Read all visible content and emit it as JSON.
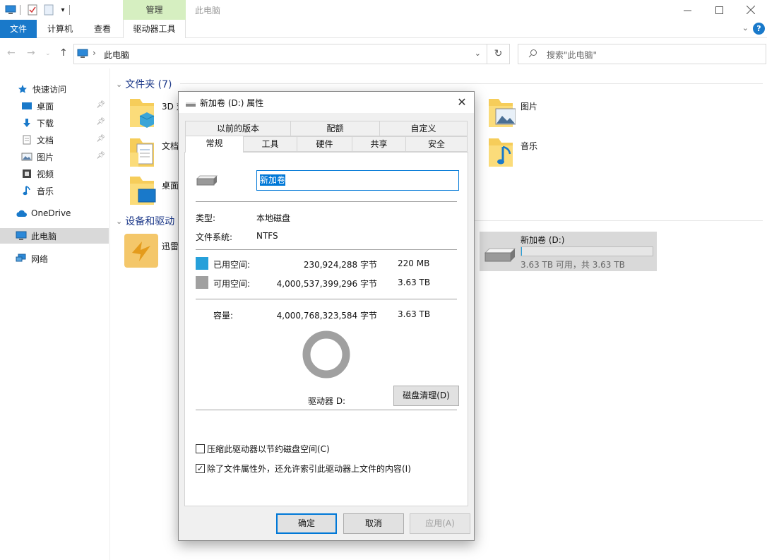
{
  "window": {
    "title": "此电脑",
    "manage_tab": "管理"
  },
  "ribbon": {
    "tabs": [
      "文件",
      "计算机",
      "查看",
      "驱动器工具"
    ]
  },
  "address": {
    "path": "此电脑",
    "search_placeholder": "搜索\"此电脑\""
  },
  "sidebar": {
    "quick_access": "快速访问",
    "items": [
      "桌面",
      "下载",
      "文档",
      "图片",
      "视频",
      "音乐"
    ],
    "onedrive": "OneDrive",
    "this_pc": "此电脑",
    "network": "网络"
  },
  "content": {
    "folders_header": "文件夹 (7)",
    "folders": [
      "3D 对",
      "文档",
      "桌面",
      "图片",
      "音乐"
    ],
    "devices_header": "设备和驱动",
    "devices": [
      "迅雷"
    ],
    "drive": {
      "name": "新加卷 (D:)",
      "free_text": "3.63 TB 可用，共 3.63 TB",
      "used_fraction": 0.003
    }
  },
  "dialog": {
    "title": "新加卷 (D:) 属性",
    "tabs_top": [
      "以前的版本",
      "配额",
      "自定义"
    ],
    "tabs_bottom": [
      "常规",
      "工具",
      "硬件",
      "共享",
      "安全"
    ],
    "volume_name": "新加卷",
    "type_label": "类型:",
    "type_value": "本地磁盘",
    "fs_label": "文件系统:",
    "fs_value": "NTFS",
    "used_label": "已用空间:",
    "used_bytes": "230,924,288 字节",
    "used_size": "220 MB",
    "free_label": "可用空间:",
    "free_bytes": "4,000,537,399,296 字节",
    "free_size": "3.63 TB",
    "capacity_label": "容量:",
    "capacity_bytes": "4,000,768,323,584 字节",
    "capacity_size": "3.63 TB",
    "drive_label": "驱动器 D:",
    "cleanup_button": "磁盘清理(D)",
    "compress_label": "压缩此驱动器以节约磁盘空间(C)",
    "compress_checked": false,
    "index_label": "除了文件属性外，还允许索引此驱动器上文件的内容(I)",
    "index_checked": true,
    "ok_button": "确定",
    "cancel_button": "取消",
    "apply_button": "应用(A)",
    "used_fraction": 6e-05,
    "colors": {
      "used": "#26a0da",
      "free": "#a0a0a0"
    }
  }
}
